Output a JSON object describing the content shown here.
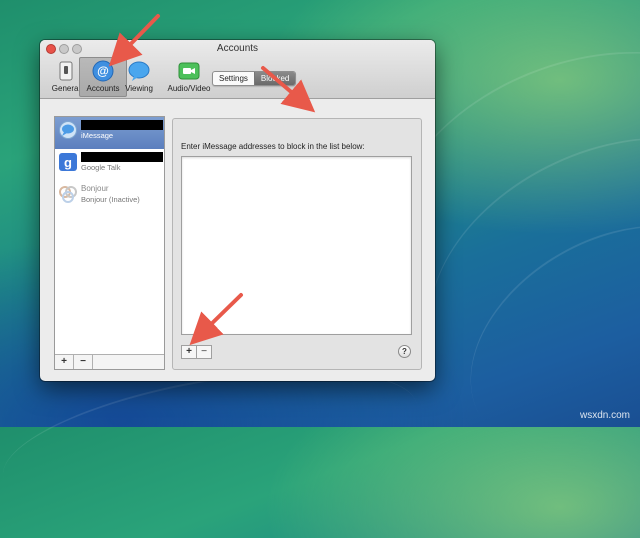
{
  "window": {
    "title": "Accounts"
  },
  "toolbar": {
    "items": [
      {
        "label": "General",
        "icon": "general-switch-icon"
      },
      {
        "label": "Accounts",
        "icon": "at-sign-icon"
      },
      {
        "label": "Viewing",
        "icon": "speech-bubble-icon"
      },
      {
        "label": "Audio/Video",
        "icon": "video-camera-icon"
      }
    ],
    "selected": "Accounts"
  },
  "sidebar": {
    "accounts": [
      {
        "name": "",
        "service": "iMessage",
        "icon": "imessage-icon",
        "selected": true
      },
      {
        "name": "",
        "service": "Google Talk",
        "icon": "google-icon",
        "selected": false
      },
      {
        "name": "Bonjour",
        "service": "Bonjour (Inactive)",
        "icon": "bonjour-icon",
        "selected": false
      }
    ],
    "add_label": "+",
    "remove_label": "−"
  },
  "tabs": {
    "settings": "Settings",
    "blocked": "Blocked",
    "active": "Blocked"
  },
  "blocked": {
    "prompt": "Enter iMessage addresses to block in the list below:",
    "add_label": "+",
    "remove_label": "−",
    "help_label": "?"
  },
  "watermark": "wsxdn.com",
  "colors": {
    "arrow": "#e8594a",
    "selection": "#6a8cc7",
    "close_button": "#e8534a"
  }
}
